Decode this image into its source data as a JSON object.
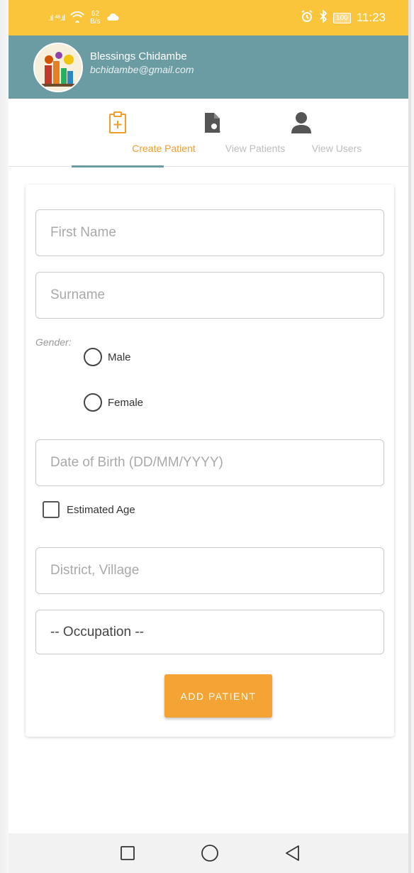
{
  "status_bar": {
    "signal": ".ıl ⁴⁶.ıl",
    "network_speed_value": "62",
    "network_speed_unit": "B/s",
    "battery": "100",
    "time": "11:23"
  },
  "header": {
    "user_name": "Blessings Chidambe",
    "user_email": "bchidambe@gmail.com"
  },
  "tabs": [
    {
      "label": "Create Patient",
      "icon": "clipboard-plus-icon",
      "active": true
    },
    {
      "label": "View Patients",
      "icon": "file-search-icon",
      "active": false
    },
    {
      "label": "View Users",
      "icon": "person-icon",
      "active": false
    }
  ],
  "form": {
    "first_name_placeholder": "First Name",
    "surname_placeholder": "Surname",
    "gender_label": "Gender:",
    "gender_options": [
      "Male",
      "Female"
    ],
    "dob_placeholder": "Date of Birth (DD/MM/YYYY)",
    "estimated_age_label": "Estimated Age",
    "district_placeholder": "District, Village",
    "occupation_selected": "-- Occupation --",
    "submit_label": "ADD PATIENT"
  },
  "colors": {
    "status_bar": "#fac43b",
    "header": "#6c9ca3",
    "accent": "#f4a335",
    "active_tab_text": "#f39d2a"
  }
}
